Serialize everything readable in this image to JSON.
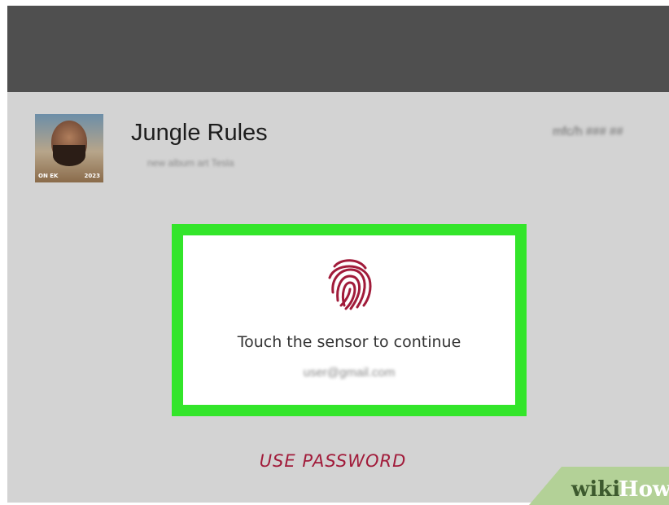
{
  "header": {
    "title": "Jungle Rules",
    "subtitle": "new album art Tesla",
    "timestamp": "mfc/h ### ##"
  },
  "avatar": {
    "caption_left": "ON EK",
    "caption_right": "2023"
  },
  "dialog": {
    "prompt": "Touch the sensor to continue",
    "account": "user@gmail.com"
  },
  "actions": {
    "use_password": "USE PASSWORD"
  },
  "watermark": {
    "part1": "wiki",
    "part2": "How"
  },
  "colors": {
    "highlight": "#33e52a",
    "accent": "#a11b3a",
    "topbar": "#4f4f4f"
  }
}
